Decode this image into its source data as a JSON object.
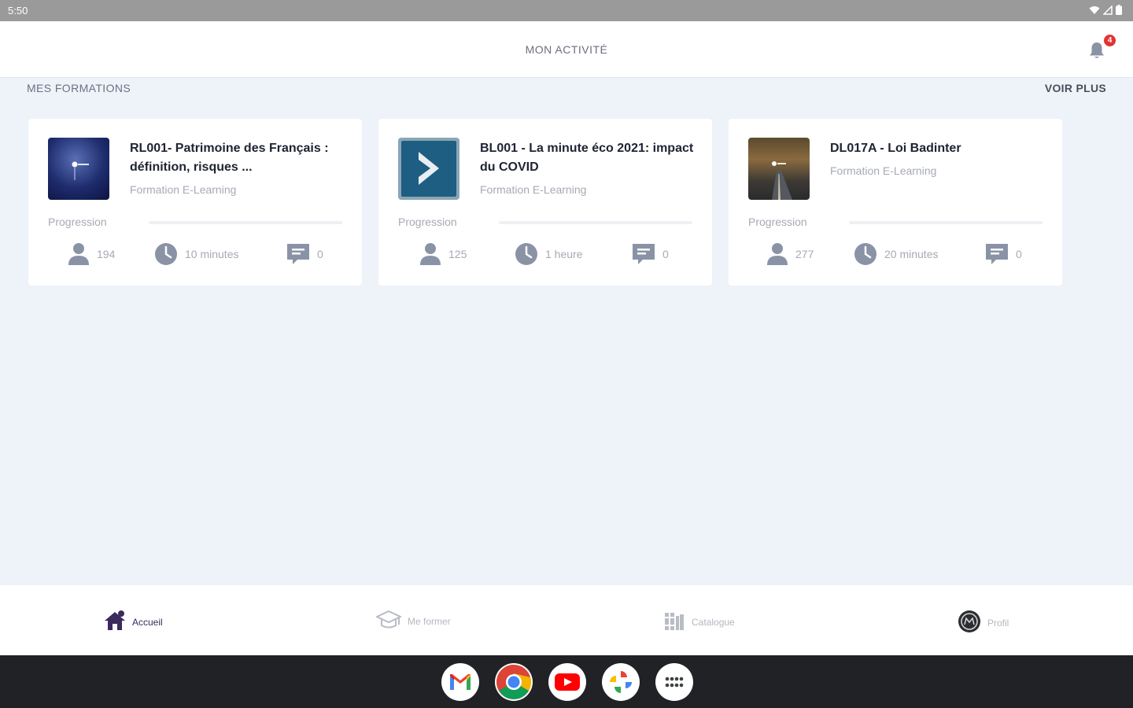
{
  "status_bar": {
    "time": "5:50"
  },
  "header": {
    "title": "MON ACTIVITÉ",
    "notification_count": "4"
  },
  "section": {
    "title": "MES FORMATIONS",
    "see_more": "VOIR PLUS"
  },
  "courses": [
    {
      "title": "RL001- Patrimoine des Français : définition, risques ...",
      "type": "Formation E-Learning",
      "progress_label": "Progression",
      "progress": 0,
      "learners": "194",
      "duration": "10 minutes",
      "comments": "0",
      "thumbnail_icon": "night-sky-thumbnail"
    },
    {
      "title": "BL001 - La minute éco 2021: impact du COVID",
      "type": "Formation E-Learning",
      "progress_label": "Progression",
      "progress": 0,
      "learners": "125",
      "duration": "1 heure",
      "comments": "0",
      "thumbnail_icon": "play-chevron-thumbnail"
    },
    {
      "title": "DL017A - Loi Badinter",
      "type": "Formation E-Learning",
      "progress_label": "Progression",
      "progress": 0,
      "learners": "277",
      "duration": "20 minutes",
      "comments": "0",
      "thumbnail_icon": "road-thumbnail"
    }
  ],
  "bottom_nav": [
    {
      "label": "Accueil",
      "icon": "home-icon",
      "active": true
    },
    {
      "label": "Me former",
      "icon": "graduation-cap-icon",
      "active": false
    },
    {
      "label": "Catalogue",
      "icon": "library-icon",
      "active": false
    },
    {
      "label": "Profil",
      "icon": "avatar-icon",
      "active": false
    }
  ],
  "dock_apps": [
    "gmail-icon",
    "chrome-icon",
    "youtube-icon",
    "photos-icon",
    "app-launcher-icon"
  ],
  "colors": {
    "background": "#eef3fa",
    "accent": "#3b2a5e",
    "badge": "#e23333",
    "muted_text": "#a5aab4",
    "stat_icon": "#8a93a6"
  }
}
